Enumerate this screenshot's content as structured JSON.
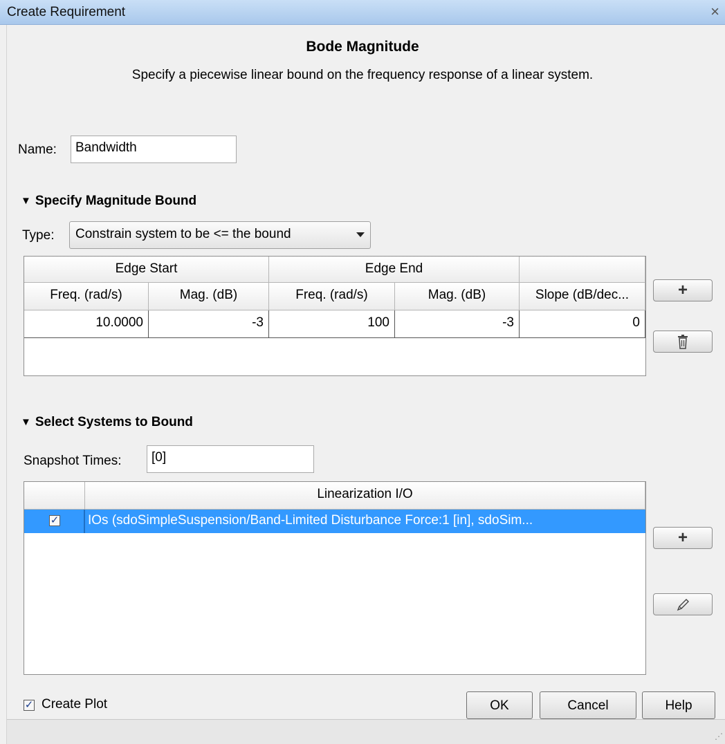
{
  "window": {
    "title": "Create Requirement",
    "close_glyph": "×"
  },
  "header": {
    "title": "Bode Magnitude",
    "description": "Specify a piecewise linear bound on the frequency response of a linear system."
  },
  "name_field": {
    "label": "Name:",
    "value": "Bandwidth"
  },
  "magnitude_section": {
    "title": "Specify Magnitude Bound",
    "type_label": "Type:",
    "type_value": "Constrain system to be <= the bound",
    "table": {
      "group_headers": [
        "Edge Start",
        "Edge End",
        ""
      ],
      "columns": [
        "Freq. (rad/s)",
        "Mag. (dB)",
        "Freq. (rad/s)",
        "Mag. (dB)",
        "Slope (dB/dec..."
      ],
      "rows": [
        [
          "10.0000",
          "-3",
          "100",
          "-3",
          "0"
        ]
      ]
    },
    "add_icon": "plus-icon",
    "delete_icon": "trash-icon"
  },
  "systems_section": {
    "title": "Select Systems to Bound",
    "snapshot_label": "Snapshot Times:",
    "snapshot_value": "[0]",
    "table": {
      "columns": [
        "",
        "Linearization I/O"
      ],
      "rows": [
        {
          "checked": true,
          "io": "IOs (sdoSimpleSuspension/Band-Limited Disturbance Force:1 [in], sdoSim..."
        }
      ]
    },
    "add_icon": "plus-icon",
    "edit_icon": "pencil-icon"
  },
  "footer": {
    "create_plot_label": "Create Plot",
    "create_plot_checked": true,
    "ok_label": "OK",
    "cancel_label": "Cancel",
    "help_label": "Help"
  },
  "colors": {
    "selection": "#3399ff",
    "titlebar": "#b9d4f1"
  }
}
